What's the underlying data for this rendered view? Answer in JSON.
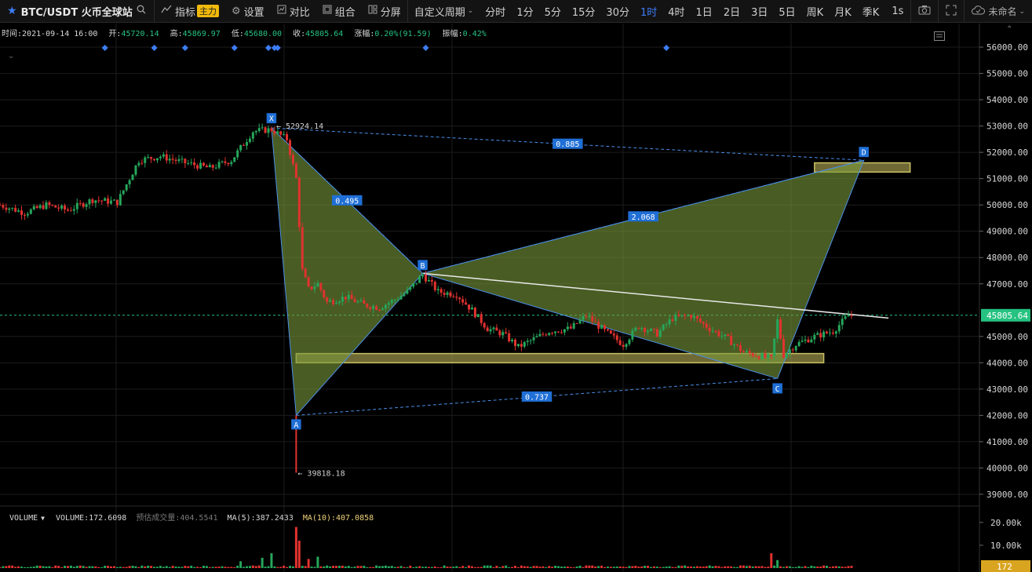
{
  "toolbar": {
    "symbol": "BTC/USDT 火币全球站",
    "indicators_label": "指标",
    "indicators_badge": "主力",
    "settings_label": "设置",
    "compare_label": "对比",
    "combine_label": "组合",
    "split_label": "分屏",
    "custom_period_label": "自定义周期",
    "periods": [
      "分时",
      "1分",
      "5分",
      "15分",
      "30分",
      "1时",
      "4时",
      "1日",
      "2日",
      "3日",
      "5日",
      "周K",
      "月K",
      "季K"
    ],
    "active_period": "1时",
    "refresh": "1s",
    "user": "未命名"
  },
  "info": {
    "time_label": "时间:",
    "time": "2021-09-14 16:00",
    "open_label": "开:",
    "open": "45720.14",
    "high_label": "高:",
    "high": "45869.97",
    "low_label": "低:",
    "low": "45680.00",
    "close_label": "收:",
    "close": "45805.64",
    "change_label": "涨幅:",
    "change": "0.20%(91.59)",
    "amplitude_label": "振幅:",
    "amplitude": "0.42%"
  },
  "volume_info": {
    "name": "VOLUME",
    "volume": "VOLUME:172.6098",
    "estimate": "预估成交量:404.5541",
    "ma5": "MA(5):387.2433",
    "ma10": "MA(10):407.0858"
  },
  "colors": {
    "up": "#26a65b",
    "down": "#e0322f",
    "pattern_fill": "#7a9a3a",
    "pattern_edge": "#4a8ee8",
    "zone": "#c8c060",
    "trendline": "#e8e8e8",
    "last_price": "#26c281",
    "volume_badge": "#d9a520"
  },
  "chart_data": {
    "type": "candlestick",
    "symbol": "BTC/USDT",
    "interval": "1时",
    "y_axis": {
      "ticks": [
        "56000.00",
        "55000.00",
        "54000.00",
        "53000.00",
        "52000.00",
        "51000.00",
        "50000.00",
        "49000.00",
        "48000.00",
        "47000.00",
        "45000.00",
        "44000.00",
        "43000.00",
        "42000.00",
        "41000.00",
        "40000.00",
        "39000.00"
      ],
      "range": [
        38700,
        56300
      ]
    },
    "volume_axis": {
      "ticks": [
        "20.00k",
        "10.00k"
      ],
      "last": "172"
    },
    "last_price": "45805.64",
    "price_path": [
      [
        0,
        50000
      ],
      [
        8,
        49700
      ],
      [
        15,
        50000
      ],
      [
        22,
        49800
      ],
      [
        30,
        50200
      ],
      [
        38,
        50100
      ],
      [
        45,
        51700
      ],
      [
        52,
        51850
      ],
      [
        60,
        51600
      ],
      [
        68,
        51400
      ],
      [
        75,
        51700
      ],
      [
        82,
        52800
      ],
      [
        88,
        52870
      ],
      [
        93,
        52500
      ],
      [
        96,
        51000
      ],
      [
        98,
        47500
      ],
      [
        100,
        46800
      ],
      [
        103,
        47000
      ],
      [
        106,
        46300
      ],
      [
        112,
        46500
      ],
      [
        118,
        46200
      ],
      [
        123,
        46100
      ],
      [
        128,
        46400
      ],
      [
        132,
        46700
      ],
      [
        137,
        47350
      ],
      [
        142,
        46700
      ],
      [
        148,
        46600
      ],
      [
        153,
        46000
      ],
      [
        158,
        45300
      ],
      [
        163,
        45100
      ],
      [
        168,
        44600
      ],
      [
        173,
        44900
      ],
      [
        178,
        45200
      ],
      [
        185,
        45300
      ],
      [
        190,
        45800
      ],
      [
        196,
        45200
      ],
      [
        202,
        44700
      ],
      [
        207,
        45400
      ],
      [
        213,
        45100
      ],
      [
        218,
        45700
      ],
      [
        224,
        45800
      ],
      [
        230,
        45300
      ],
      [
        236,
        44900
      ],
      [
        241,
        44400
      ],
      [
        245,
        44300
      ],
      [
        250,
        44150
      ],
      [
        252,
        45600
      ],
      [
        254,
        44300
      ],
      [
        258,
        44700
      ],
      [
        264,
        45000
      ],
      [
        270,
        45200
      ],
      [
        275,
        45800
      ]
    ],
    "x_range": [
      0,
      276
    ],
    "harmonic_pattern": {
      "points": [
        {
          "label": "X",
          "price": 52924.14,
          "x": 88
        },
        {
          "label": "A",
          "price": 42000,
          "x": 96
        },
        {
          "label": "B",
          "price": 47400,
          "x": 137
        },
        {
          "label": "C",
          "price": 43400,
          "x": 252
        },
        {
          "label": "D",
          "price": 51700,
          "x": 280
        }
      ],
      "ratios": [
        {
          "label": "0.495",
          "between": "XB"
        },
        {
          "label": "0.885",
          "between": "XD"
        },
        {
          "label": "2.068",
          "between": "BD"
        },
        {
          "label": "0.737",
          "between": "AC"
        }
      ],
      "x_price_label": "52924.14",
      "a_low_label": "39818.18",
      "a_low_price": 39818.18
    },
    "zones": [
      {
        "from_x": 96,
        "to_x": 267,
        "low": 44000,
        "high": 44350
      },
      {
        "from_x": 264,
        "to_x": 295,
        "low": 51250,
        "high": 51600
      }
    ],
    "trendline": {
      "from": [
        137,
        47400
      ],
      "to": [
        288,
        45700
      ]
    },
    "event_markers_x": [
      34,
      50,
      60,
      76,
      87,
      89,
      90,
      138,
      216
    ],
    "volume": {
      "spikes": [
        [
          78,
          3000
        ],
        [
          85,
          4500
        ],
        [
          88,
          6500
        ],
        [
          96,
          18000
        ],
        [
          97,
          12000
        ],
        [
          100,
          4000
        ],
        [
          103,
          5000
        ],
        [
          250,
          6500
        ],
        [
          252,
          3500
        ]
      ],
      "baseline": 900
    }
  }
}
